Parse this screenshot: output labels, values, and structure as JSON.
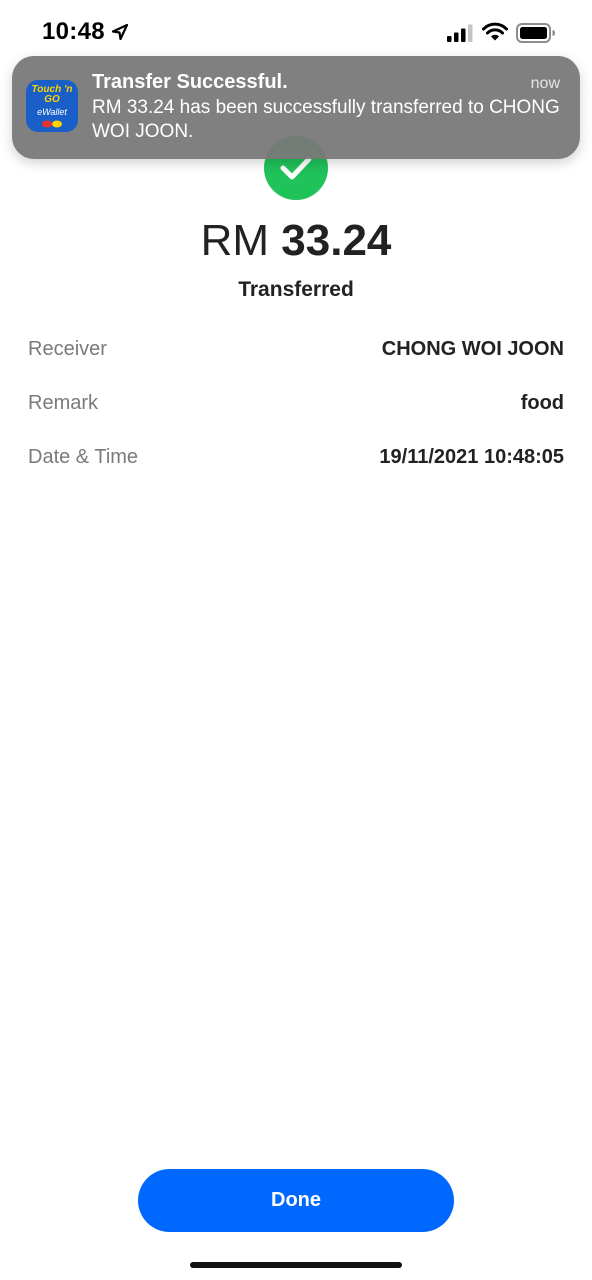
{
  "status_bar": {
    "time": "10:48",
    "icons": [
      "location-arrow-icon",
      "cellular-signal-icon",
      "wifi-icon",
      "battery-icon"
    ]
  },
  "notification": {
    "app_icon_text_top": "Touch 'n GO",
    "app_icon_text_bottom": "eWallet",
    "title": "Transfer Successful.",
    "time": "now",
    "body": "RM 33.24 has been successfully transferred to CHONG WOI JOON."
  },
  "receipt": {
    "currency": "RM",
    "amount": "33.24",
    "status": "Transferred",
    "success_color": "#20c25a",
    "details": [
      {
        "label": "Receiver",
        "value": "CHONG WOI JOON"
      },
      {
        "label": "Remark",
        "value": "food"
      },
      {
        "label": "Date & Time",
        "value": "19/11/2021 10:48:05"
      }
    ]
  },
  "actions": {
    "done_label": "Done",
    "primary_color": "#0068ff"
  }
}
